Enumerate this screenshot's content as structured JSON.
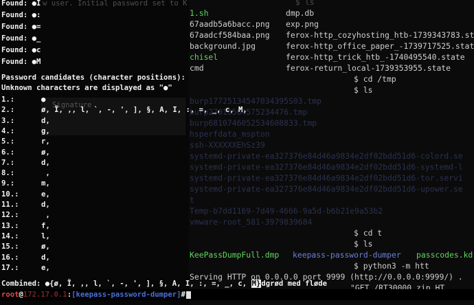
{
  "found": [
    {
      "label": "Found:",
      "ch": "●I"
    },
    {
      "label": "Found:",
      "ch": "●:"
    },
    {
      "label": "Found:",
      "ch": "●="
    },
    {
      "label": "Found:",
      "ch": "●_"
    },
    {
      "label": "Found:",
      "ch": "●c"
    },
    {
      "label": "Found:",
      "ch": "●M"
    }
  ],
  "ghost_line": "w user. Initial password set to K",
  "ghost_tab": "Signature",
  "header1": "Password candidates (character positions):",
  "header2": "Unknown characters are displayed as \"●\"",
  "positions": [
    {
      "idx": "1.:",
      "val": "●"
    },
    {
      "idx": "2.:",
      "val": "ø, Ï, ,, l, `, -, ', ], §, A, I, :, =, _, c, M,"
    },
    {
      "idx": "3.:",
      "val": "d,"
    },
    {
      "idx": "4.:",
      "val": "g,"
    },
    {
      "idx": "5.:",
      "val": "r,"
    },
    {
      "idx": "6.:",
      "val": "ø,"
    },
    {
      "idx": "7.:",
      "val": "d,"
    },
    {
      "idx": "8.:",
      "val": " ,"
    },
    {
      "idx": "9.:",
      "val": "m,"
    },
    {
      "idx": "10.:",
      "val": "e,"
    },
    {
      "idx": "11.:",
      "val": "d,"
    },
    {
      "idx": "12.:",
      "val": " ,"
    },
    {
      "idx": "13.:",
      "val": "f,"
    },
    {
      "idx": "14.:",
      "val": "l,"
    },
    {
      "idx": "15.:",
      "val": "ø,"
    },
    {
      "idx": "16.:",
      "val": "d,"
    },
    {
      "idx": "17.:",
      "val": "e,"
    }
  ],
  "combined": {
    "label": "Combined:",
    "prefix": " ●{ø, Ï, ,, l, `, -, ', ], §, A, I, :, =, _, c, ",
    "highlight": "M}",
    "suffix": "dgrød med fløde"
  },
  "prompt": {
    "user": "root",
    "at": "@",
    "host": "172.17.0.1",
    "sep": ":",
    "dir": "[keepass-password-dumper]",
    "symbol": "#"
  },
  "bg_files": [
    {
      "a": "1.sh",
      "b": "dmp.db",
      "a_green": true
    },
    {
      "a": "67aadb5a6bacc.png",
      "b": "exp.png"
    },
    {
      "a": "67aadcf584baa.png",
      "b": "ferox-http_cozyhosting_htb-1739343783.st"
    },
    {
      "a": "background.jpg",
      "b": "ferox-http_office_paper_-1739717525.stat"
    },
    {
      "a": "chisel",
      "b": "ferox-http_trick_htb_-1740495540.state",
      "a_green": true
    },
    {
      "a": "cmd",
      "b": "ferox-return_local-1739353955.state"
    }
  ],
  "bg_top": "$ ls",
  "bg_cmds": [
    {
      "text": "$ cd /tmp"
    },
    {
      "text": "$ ls"
    }
  ],
  "bg_tmp": [
    "burp17725134547034395S03.tmp",
    "burp27016564575234476.tmp",
    "burp6810746052534608833.tmp",
    "hsperfdata_mspton",
    "ssh-XXXXXXEhSz39",
    "systemd-private-ea327376e84d46a9834e2df02bdd51d6-colord.se",
    "systemd-private-ea327376e84d46a9834e2df02bdd51d6-systemd-l",
    "systemd-private-ea327376e84d46a9834e2df02bdd51d6-tor.servi",
    "systemd-private-ea327376e84d46a9834e2df02bdd51d6-upower.se",
    "t",
    "Temp-b7dd1169-7d49-4666-9a5d-b6b21e9a53b2",
    "vmware-root_581-3979839684"
  ],
  "bg_cd": "$ cd t",
  "bg_ls2": "$ ls",
  "bg_files2": [
    "KeePassDumpFull.dmp",
    "keepass-password-dumper",
    "passcodes.kd"
  ],
  "bg_http": "$ python3 -m htt",
  "bg_serving": "Serving HTTP on 0.0.0.0 port 9999 (http://0.0.0.0:9999/) .",
  "bg_get": "\"GET /RT30000.zip HT"
}
